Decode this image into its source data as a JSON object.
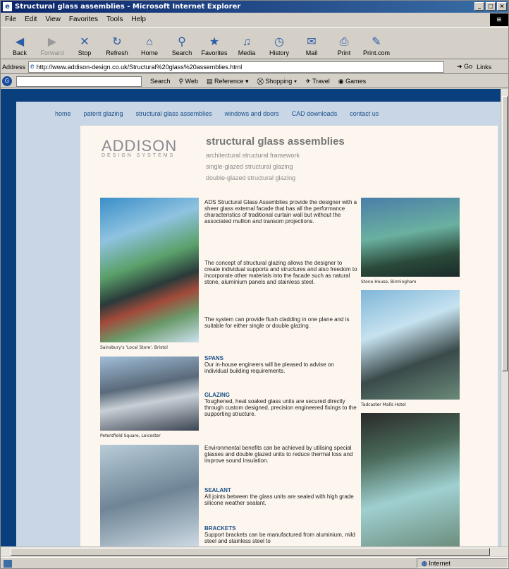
{
  "window": {
    "title": "Structural glass assemblies - Microsoft Internet Explorer",
    "minimize": "_",
    "maximize": "□",
    "close": "×"
  },
  "menu": [
    "File",
    "Edit",
    "View",
    "Favorites",
    "Tools",
    "Help"
  ],
  "toolbar": [
    {
      "label": "Back",
      "icon": "back-arrow-icon",
      "enabled": true
    },
    {
      "label": "Forward",
      "icon": "forward-arrow-icon",
      "enabled": false
    },
    {
      "label": "Stop",
      "icon": "stop-icon",
      "enabled": true
    },
    {
      "label": "Refresh",
      "icon": "refresh-icon",
      "enabled": true
    },
    {
      "label": "Home",
      "icon": "home-icon",
      "enabled": true
    },
    {
      "label": "Search",
      "icon": "search-icon",
      "enabled": true
    },
    {
      "label": "Favorites",
      "icon": "favorites-icon",
      "enabled": true
    },
    {
      "label": "Media",
      "icon": "media-icon",
      "enabled": true
    },
    {
      "label": "History",
      "icon": "history-icon",
      "enabled": true
    },
    {
      "label": "Mail",
      "icon": "mail-icon",
      "enabled": true
    },
    {
      "label": "Print",
      "icon": "print-icon",
      "enabled": true
    },
    {
      "label": "Print.com",
      "icon": "printcom-icon",
      "enabled": true
    }
  ],
  "address": {
    "label": "Address",
    "url": "http://www.addison-design.co.uk/Structural%20glass%20assemblies.html",
    "go": "Go",
    "links": "Links"
  },
  "searchbar": {
    "search": "Search",
    "web": "Web",
    "reference": "Reference",
    "shopping": "Shopping",
    "travel": "Travel",
    "games": "Games"
  },
  "status": {
    "zone": "Internet"
  },
  "site": {
    "nav": [
      "home",
      "patent glazing",
      "structural glass assemblies",
      "windows and doors",
      "CAD downloads",
      "contact us"
    ],
    "logo": {
      "name": "ADDISON",
      "sub": "DESIGN SYSTEMS"
    },
    "heading": "structural glass assemblies",
    "subtitles": [
      "architectural structural framework",
      "single-glazed structural glazing",
      "double-glazed structural glazing"
    ],
    "captions": {
      "left1": "Sainsbury's 'Local Store', Bristol",
      "left2": "Petersfield Square, Leicester",
      "right1": "Stone House, Birmingham",
      "right2": "Tadcaster Malls Hotel"
    },
    "intro": "ADS Structural Glass Assemblies provide the designer with a sheer glass external facade that has all the performance characteristics of traditional curtain wall but without the associated mullion and transom projections.",
    "para2": "The concept of structural glazing allows the designer to create individual supports and structures and also freedom to incorporate other materials into the facade such as natural stone, aluminium panels and stainless steel.",
    "para3": "The system can provide flush cladding in one plane and is suitable for either single or double glazing.",
    "spans_h": "SPANS",
    "spans": "Our in-house engineers will be pleased to advise on individual building requirements.",
    "glazing_h": "GLAZING",
    "glazing": "Toughened, heat soaked glass units are secured directly through custom designed, precision engineered fixings to the supporting structure.",
    "env": "Environmental benefits can be achieved by utilising special glasses and double glazed units to reduce thermal loss and improve sound insulation.",
    "sealant_h": "SEALANT",
    "sealant": "All joints between the glass units are sealed with high grade silicone weather sealant.",
    "brackets_h": "BRACKETS",
    "brackets": "Support brackets can be manufactured from aluminium, mild steel and stainless steel to"
  }
}
